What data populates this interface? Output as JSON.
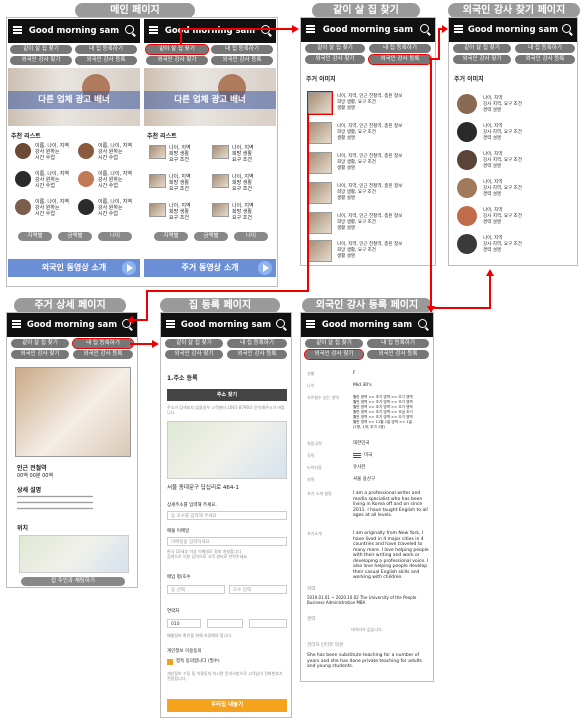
{
  "titles": {
    "main": "메인 페이지",
    "roommate": "같이 살 집 찾기",
    "teacher": "외국인 강사 찾기 페이지",
    "detail": "주거 상세 페이지",
    "register_house": "집 등록 페이지",
    "register_teacher": "외국인 강사 등록 페이지"
  },
  "app_title": "Good morning sam",
  "nav": {
    "find_house": "같이 살 집 찾기",
    "register_house": "내 집 등록하기",
    "find_teacher": "외국인 강사 찾기",
    "register_teacher": "외국인 강사 등록"
  },
  "nav_alt": {
    "find_house": "같이 살 집 찾기",
    "register_house": "내 집 등록하기",
    "find_teacher": "외국인 강사 찾기",
    "register_teacher": "외국인 강사 등록"
  },
  "banner": "다른 업체 광고 배너",
  "recommend": "추천 리스트",
  "person_text": "이름, 나이, 지역\n강사 원하는\n시간 수업",
  "room_text": "나이, 지역\n희망 생활\n요구 조건",
  "filters": [
    "지역별",
    "금액별",
    "나이"
  ],
  "video_foreign": "외국인 동영상 소개",
  "video_house": "주거 동영상 소개",
  "house_images": "주거 이미지",
  "house_item": "나이, 지역, 인근 전철역, 층된 정보\n희망 생활, 요구 조건\n생활 설명",
  "teacher_images": "주거 이미지",
  "teacher_item": "나이, 지역\n강사 지역, 요구 조건\n경력 설명",
  "detail": {
    "station": "인근 전철역",
    "price": "00역 00분 00역",
    "desc_title": "상세 설명",
    "desc_lines": "**************************************\n**************************************\n**************************************",
    "location": "위치",
    "contact": "집 주인과 채팅하기"
  },
  "register": {
    "section": "1.주소 등록",
    "search_btn": "주소 찾기",
    "notice": "주소가 검색되지 않을경우 고객센터 1661-8790로 문의해주시기 바랍니다.",
    "address": "서울 동대문구 답십리로 464-1",
    "detail_addr_label": "상세주소를 입력해 주세요.",
    "detail_addr_ph": "동 호수를 입력해 주세요",
    "email_label": "매물 이메일",
    "email_ph": "이메일을 입력하세요",
    "email_note": "한국 10세부 이상 이메일로 정보 개설합니다.\n검색으로 이용 입력으로 고객 센터로 연락주세요.",
    "area_label": "매입 평/호수",
    "area_ph1": "동 선택",
    "area_ph2": "호수 입력",
    "phone_label": "연락처",
    "phone_prefix": "010",
    "phone_note": "매물정보 확인을 위해 저장해야 합니다.",
    "privacy_label": "개인정보 이용동의",
    "privacy_check": "정독 동의합니다 (필수)",
    "privacy_note": "개인정보 수집 및 이용동의 하시면 문의사항으로 고객님이 전화번호가 전달됩니다.",
    "submit": "우리집 내놓기"
  },
  "teacher_reg": {
    "rows": [
      {
        "k": "성별",
        "v": "F"
      },
      {
        "k": "나이",
        "v": "Mid 30's"
      },
      {
        "k": "가르칠수 있는 영역",
        "v": "월반 영역 >> 조기 영역 >> 조기 영역\n월반 영역 >> 조기 영역 >> 조기 영역\n월반 영역 >> 조기 영역 >> 조기 영역\n월반 영역 >> 조기 영역 >> 조금 조기\n월반 영역 >> 조기 영역 >> 조기 영역\n월반 영역 >> 11월 1일 영역 >> 1일\n(2명, 1개, 추가 1명)"
      },
      {
        "k": "희망국적",
        "v": "대한민국"
      },
      {
        "k": "국적",
        "v": "미국"
      },
      {
        "k": "누락자정",
        "v": "유사한"
      },
      {
        "k": "지역",
        "v": "서울 용산구"
      }
    ],
    "intro_label": "자기 소개 설명",
    "intro1": "I am a professional writer and media specialist who has been living in Korea off and on since 2011. I have taught English to all ages at all levels.",
    "intro_label2": "자기소개",
    "intro2": "I am originally from New York, I have lived in 4 major cities in 4 countries and have traveled to many more. I love helping people with their writing and work or developing a professional voice. I also love helping people develop their casual English skills and working with children.",
    "edu_label": "학력",
    "edu": "2019.01.01 ~ 2020.10.02  The University of the People Business Administration MBA",
    "career_label": "경력",
    "career": "데이터가 없습니다.",
    "comment_label": "관리자 인터뷰 의견",
    "comment": "She has been substitute teaching for a number of years and she has done private teaching for adults and young students."
  }
}
